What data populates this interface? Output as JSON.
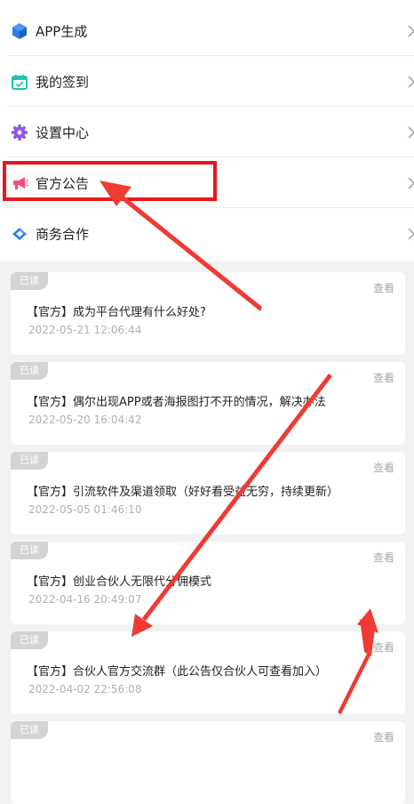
{
  "menu": [
    {
      "label": "APP生成",
      "icon": "cube-icon"
    },
    {
      "label": "我的签到",
      "icon": "calendar-check-icon"
    },
    {
      "label": "设置中心",
      "icon": "gear-icon"
    },
    {
      "label": "官方公告",
      "icon": "megaphone-icon"
    },
    {
      "label": "商务合作",
      "icon": "handshake-diamond-icon"
    }
  ],
  "announcements": [
    {
      "badge": "已读",
      "view": "查看",
      "title": "【官方】成为平台代理有什么好处?",
      "time": "2022-05-21 12:06:44"
    },
    {
      "badge": "已读",
      "view": "查看",
      "title": "【官方】偶尔出现APP或者海报图打不开的情况，解决办法",
      "time": "2022-05-20 16:04:42"
    },
    {
      "badge": "已读",
      "view": "查看",
      "title": "【官方】引流软件及渠道领取（好好看受益无穷，持续更新）",
      "time": "2022-05-05 01:46:10"
    },
    {
      "badge": "已读",
      "view": "查看",
      "title": "【官方】创业合伙人无限代分佣模式",
      "time": "2022-04-16 20:49:07"
    },
    {
      "badge": "已读",
      "view": "查看",
      "title": "【官方】合伙人官方交流群（此公告仅合伙人可查看加入）",
      "time": "2022-04-02 22:56:08"
    },
    {
      "badge": "已读",
      "view": "查看",
      "title": "",
      "time": ""
    }
  ],
  "colors": {
    "highlight": "#e8171d",
    "arrow": "#ef3b34",
    "badge": "#d4d4d4",
    "icon_blue": "#2f7be5",
    "icon_teal": "#22c3b0",
    "icon_purple": "#8c57e8",
    "icon_pink": "#f0507b"
  }
}
